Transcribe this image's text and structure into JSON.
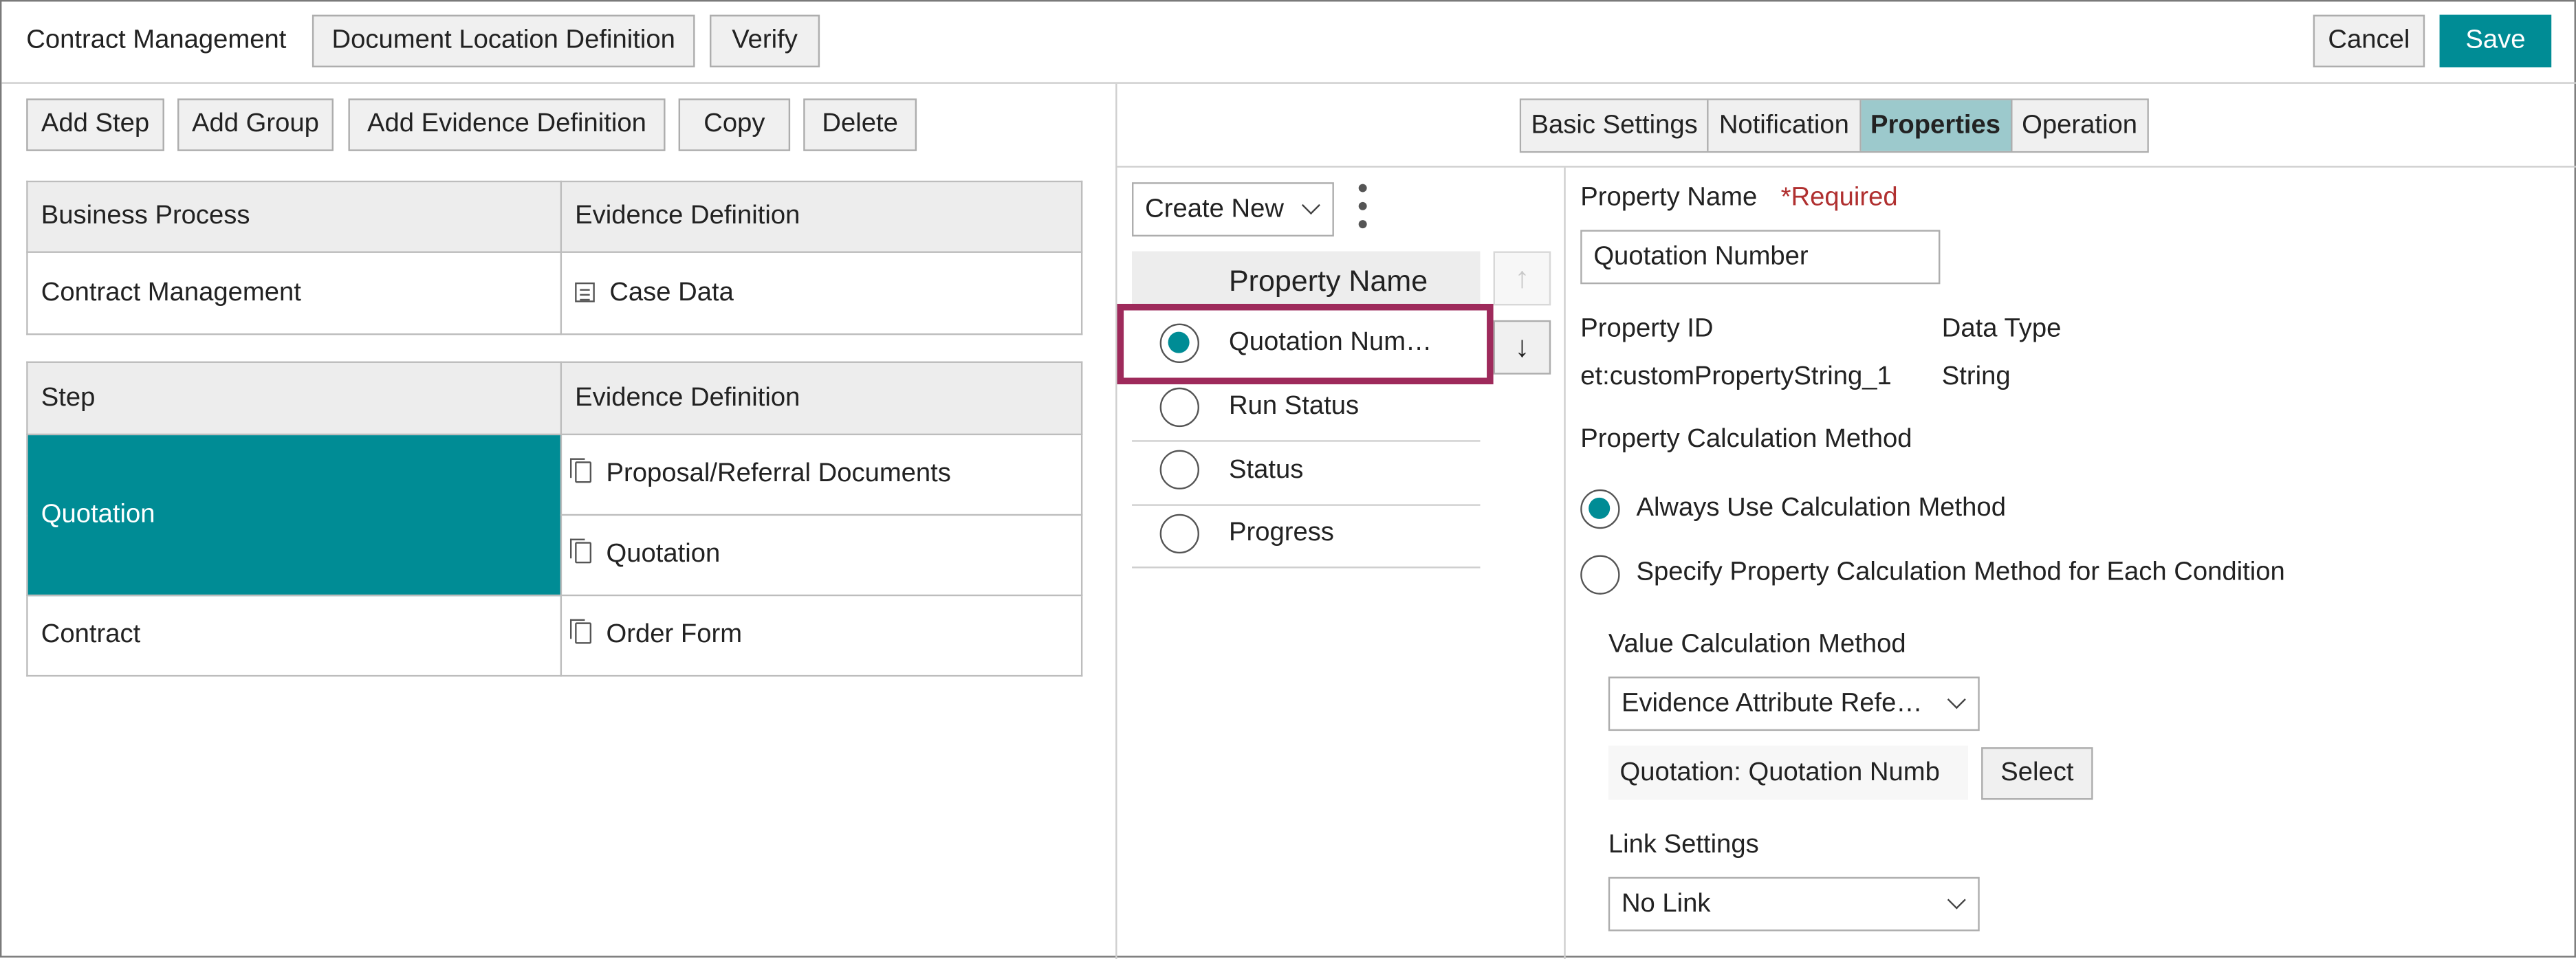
{
  "header": {
    "title": "Contract Management",
    "doc_location_btn": "Document Location Definition",
    "verify_btn": "Verify",
    "cancel_btn": "Cancel",
    "save_btn": "Save"
  },
  "toolbar": {
    "add_step": "Add Step",
    "add_group": "Add Group",
    "add_evidence": "Add Evidence Definition",
    "copy": "Copy",
    "delete": "Delete"
  },
  "process_table": {
    "col1": "Business Process",
    "col2": "Evidence Definition",
    "row": {
      "process": "Contract Management",
      "evidence": "Case Data"
    }
  },
  "step_table": {
    "col1": "Step",
    "col2": "Evidence Definition",
    "rows": [
      {
        "step": "Quotation",
        "evidence": [
          "Proposal/Referral Documents",
          "Quotation"
        ]
      },
      {
        "step": "Contract",
        "evidence": [
          "Order Form"
        ]
      }
    ]
  },
  "tabs": [
    "Basic Settings",
    "Notification",
    "Properties",
    "Operation"
  ],
  "active_tab": "Properties",
  "properties_list": {
    "create_new": "Create New",
    "header": "Property Name",
    "items": [
      "Quotation Num…",
      "Run Status",
      "Status",
      "Progress"
    ],
    "selected_index": 0
  },
  "detail": {
    "property_name_label": "Property Name",
    "required_label": "*Required",
    "property_name_value": "Quotation Number",
    "property_id_label": "Property ID",
    "property_id_value": "et:customPropertyString_1",
    "data_type_label": "Data Type",
    "data_type_value": "String",
    "calc_method_label": "Property Calculation Method",
    "option_always": "Always Use Calculation Method",
    "option_each": "Specify Property Calculation Method for Each Condition",
    "value_calc_label": "Value Calculation Method",
    "value_calc_select": "Evidence Attribute Refe…",
    "reference_value": "Quotation: Quotation Numb",
    "select_btn": "Select",
    "link_settings_label": "Link Settings",
    "link_settings_select": "No Link"
  },
  "colors": {
    "accent": "#008c95",
    "active_tab": "#9cc9cc",
    "highlight": "#9e2a5b",
    "required": "#b03030"
  },
  "icons": [
    "list-icon",
    "document-icon",
    "kebab-menu-icon",
    "arrow-up-icon",
    "arrow-down-icon",
    "chevron-down-icon"
  ]
}
